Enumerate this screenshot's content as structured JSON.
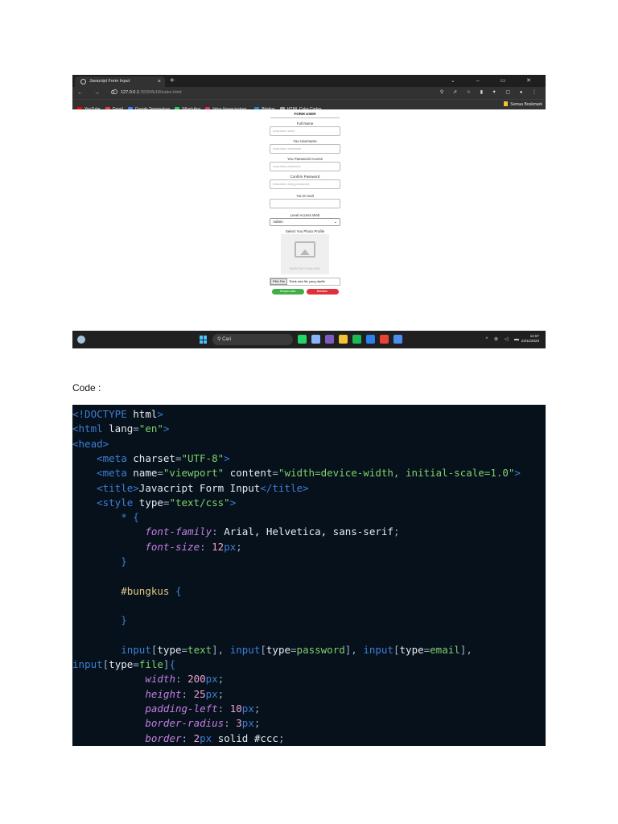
{
  "browser": {
    "tab_title": "Javacript Form Input",
    "tab_close": "×",
    "new_tab": "+",
    "window_controls": "⌄ – ▭ ✕",
    "nav_buttons": "← → C",
    "url_host": "127.0.0.1",
    "url_path": ":3000/fb18/index.html",
    "right_icons": "⚲ ⇗ ☆ ▮ ✦ ▢ ● ⋮",
    "bookmarks": [
      {
        "label": "YouTube",
        "color": "#ff0000"
      },
      {
        "label": "Gmail",
        "color": "#ea4335"
      },
      {
        "label": "Google Terjemahan",
        "color": "#4285f4"
      },
      {
        "label": "WhatsApp",
        "color": "#25d366"
      },
      {
        "label": "https://www.instagr...",
        "color": "#e1306c"
      },
      {
        "label": "Bitation",
        "color": "#1e88e5"
      },
      {
        "label": "HTML Color Codes...",
        "color": "#9e9e9e"
      }
    ],
    "all_bookmarks": "Semua Bookmark"
  },
  "form": {
    "title": "FORM USER",
    "full_name_label": "Full Name",
    "full_name_placeholder": "masukan name",
    "username_label": "You Username",
    "username_placeholder": "masukan username",
    "password_label": "You Password Access",
    "password_placeholder": "masukan password",
    "confirm_label": "Confirm Password",
    "confirm_placeholder": "masukan ulang password",
    "email_label": "You E-mail",
    "level_label": "Level Access Web",
    "level_selected": "Admin",
    "photo_label": "Select You Photo Profile",
    "image_na": "IMAGE NOT AVAILABLE",
    "file_button": "Pilih File",
    "file_status": "Tidak ada file yang dipilih",
    "save_button": "Simpan data",
    "cancel_button": "Batalkan"
  },
  "taskbar": {
    "search": "Cari",
    "tray": "^ ⊕ ◁ ▬",
    "time": "12.57",
    "date": "23/11/2023",
    "app_colors": [
      "#25d366",
      "#8ab4f8",
      "#7c5cbf",
      "#f1c232",
      "#1db954",
      "#2f80ed",
      "#ea4335",
      "#4b8ef0"
    ]
  },
  "caption": "Code :",
  "code_lines": [
    {
      "indent": 0,
      "tokens": [
        [
          "tag",
          "<!DOCTYPE "
        ],
        [
          "name",
          "html"
        ],
        [
          "tag",
          ">"
        ]
      ]
    },
    {
      "indent": 0,
      "tokens": [
        [
          "tag",
          "<html "
        ],
        [
          "attr",
          "lang"
        ],
        [
          "punc",
          "="
        ],
        [
          "str",
          "\"en\""
        ],
        [
          "tag",
          ">"
        ]
      ]
    },
    {
      "indent": 0,
      "tokens": [
        [
          "tag",
          "<head>"
        ]
      ]
    },
    {
      "indent": 4,
      "tokens": [
        [
          "tag",
          "<meta "
        ],
        [
          "attr",
          "charset"
        ],
        [
          "punc",
          "="
        ],
        [
          "str",
          "\"UTF-8\""
        ],
        [
          "tag",
          ">"
        ]
      ]
    },
    {
      "indent": 4,
      "tokens": [
        [
          "tag",
          "<meta "
        ],
        [
          "attr",
          "name"
        ],
        [
          "punc",
          "="
        ],
        [
          "str",
          "\"viewport\""
        ],
        [
          "attr",
          " content"
        ],
        [
          "punc",
          "="
        ],
        [
          "str",
          "\"width=device-width, initial-scale=1.0\""
        ],
        [
          "tag",
          ">"
        ]
      ]
    },
    {
      "indent": 4,
      "tokens": [
        [
          "tag",
          "<title>"
        ],
        [
          "text",
          "Javacript Form Input"
        ],
        [
          "tag",
          "</title>"
        ]
      ]
    },
    {
      "indent": 4,
      "tokens": [
        [
          "tag",
          "<style "
        ],
        [
          "attr",
          "type"
        ],
        [
          "punc",
          "="
        ],
        [
          "str",
          "\"text/css\""
        ],
        [
          "tag",
          ">"
        ]
      ]
    },
    {
      "indent": 8,
      "tokens": [
        [
          "tag",
          "* "
        ],
        [
          "brace",
          "{"
        ]
      ]
    },
    {
      "indent": 12,
      "tokens": [
        [
          "prop",
          "font-family"
        ],
        [
          "punc",
          ": "
        ],
        [
          "val",
          "Arial, Helvetica, sans-serif"
        ],
        [
          "punc",
          ";"
        ]
      ]
    },
    {
      "indent": 12,
      "tokens": [
        [
          "prop",
          "font-size"
        ],
        [
          "punc",
          ": "
        ],
        [
          "num",
          "12"
        ],
        [
          "unit",
          "px"
        ],
        [
          "punc",
          ";"
        ]
      ]
    },
    {
      "indent": 8,
      "tokens": [
        [
          "brace",
          "}"
        ]
      ]
    },
    {
      "indent": 0,
      "tokens": []
    },
    {
      "indent": 8,
      "tokens": [
        [
          "sel",
          "#bungkus "
        ],
        [
          "brace",
          "{"
        ]
      ]
    },
    {
      "indent": 0,
      "tokens": []
    },
    {
      "indent": 8,
      "tokens": [
        [
          "brace",
          "}"
        ]
      ]
    },
    {
      "indent": 0,
      "tokens": []
    },
    {
      "indent": 8,
      "tokens": [
        [
          "tag",
          "input"
        ],
        [
          "punc",
          "["
        ],
        [
          "attr",
          "type"
        ],
        [
          "punc",
          "="
        ],
        [
          "str",
          "text"
        ],
        [
          "punc",
          "], "
        ],
        [
          "tag",
          "input"
        ],
        [
          "punc",
          "["
        ],
        [
          "attr",
          "type"
        ],
        [
          "punc",
          "="
        ],
        [
          "str",
          "password"
        ],
        [
          "punc",
          "], "
        ],
        [
          "tag",
          "input"
        ],
        [
          "punc",
          "["
        ],
        [
          "attr",
          "type"
        ],
        [
          "punc",
          "="
        ],
        [
          "str",
          "email"
        ],
        [
          "punc",
          "],"
        ]
      ]
    },
    {
      "indent": 0,
      "tokens": [
        [
          "tag",
          "input"
        ],
        [
          "punc",
          "["
        ],
        [
          "attr",
          "type"
        ],
        [
          "punc",
          "="
        ],
        [
          "str",
          "file"
        ],
        [
          "punc",
          "]"
        ],
        [
          "brace",
          "{"
        ]
      ]
    },
    {
      "indent": 12,
      "tokens": [
        [
          "prop",
          "width"
        ],
        [
          "punc",
          ": "
        ],
        [
          "num",
          "200"
        ],
        [
          "unit",
          "px"
        ],
        [
          "punc",
          ";"
        ]
      ]
    },
    {
      "indent": 12,
      "tokens": [
        [
          "prop",
          "height"
        ],
        [
          "punc",
          ": "
        ],
        [
          "num",
          "25"
        ],
        [
          "unit",
          "px"
        ],
        [
          "punc",
          ";"
        ]
      ]
    },
    {
      "indent": 12,
      "tokens": [
        [
          "prop",
          "padding-left"
        ],
        [
          "punc",
          ": "
        ],
        [
          "num",
          "10"
        ],
        [
          "unit",
          "px"
        ],
        [
          "punc",
          ";"
        ]
      ]
    },
    {
      "indent": 12,
      "tokens": [
        [
          "prop",
          "border-radius"
        ],
        [
          "punc",
          ": "
        ],
        [
          "num",
          "3"
        ],
        [
          "unit",
          "px"
        ],
        [
          "punc",
          ";"
        ]
      ]
    },
    {
      "indent": 12,
      "tokens": [
        [
          "prop",
          "border"
        ],
        [
          "punc",
          ": "
        ],
        [
          "num",
          "2"
        ],
        [
          "unit",
          "px"
        ],
        [
          "val",
          " solid #ccc"
        ],
        [
          "punc",
          ";"
        ]
      ]
    }
  ]
}
